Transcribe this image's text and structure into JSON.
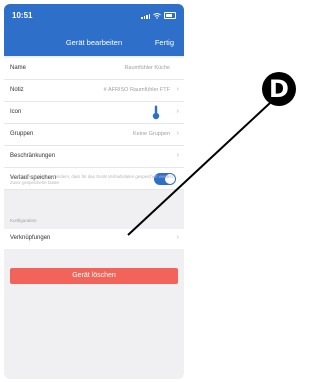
{
  "status_bar": {
    "time": "10:51"
  },
  "nav": {
    "title": "Gerät bearbeiten",
    "done_label": "Fertig"
  },
  "rows": [
    {
      "label": "Name",
      "value": "Raumfühler Küche"
    },
    {
      "label": "Notiz",
      "value": "# AFRISO Raumfühler FTF"
    },
    {
      "label": "Icon",
      "value": "",
      "icon": "thermometer-icon"
    },
    {
      "label": "Gruppen",
      "value": "Keine Gruppen"
    },
    {
      "label": "Beschränkungen",
      "value": ""
    },
    {
      "label": "Verlauf speichern",
      "toggle_on": true
    }
  ],
  "hint_text": "Ausschalten, um zu verhindern, dass für das Gerät Verlaufsdaten gespeichert werden. Zuvor gespeicherte Daten",
  "section_header": "Konfiguration",
  "link_row": {
    "label": "Verknüpfungen"
  },
  "delete_button": {
    "label": "Gerät löschen"
  },
  "callout": {
    "letter": "D"
  },
  "colors": {
    "accent": "#2e6fc9",
    "danger": "#f2645a"
  }
}
